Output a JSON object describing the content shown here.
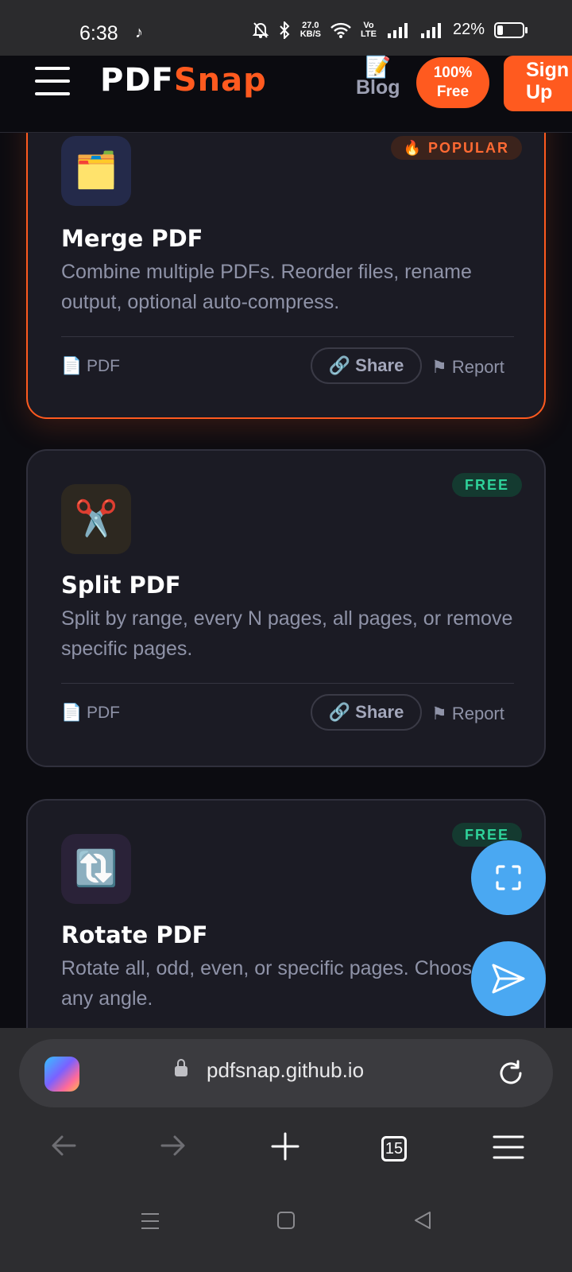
{
  "status_bar": {
    "time": "6:38",
    "speed_value": "27.0",
    "speed_unit": "KB/S",
    "volte_top": "Vo",
    "volte_bottom": "LTE",
    "battery": "22%"
  },
  "navbar": {
    "logo_part1": "PDF",
    "logo_part2": "Snap",
    "blog_label": "Blog",
    "free_line1": "100%",
    "free_line2": "Free",
    "signup_line1": "Sign",
    "signup_line2": "Up"
  },
  "cards": [
    {
      "badge": "🔥 POPULAR",
      "icon": "🗂️",
      "title": "Merge PDF",
      "description": "Combine multiple PDFs. Reorder files, rename output, optional auto-compress.",
      "file_type": "📄 PDF",
      "share_label": "🔗 Share",
      "report_label": "⚑ Report"
    },
    {
      "badge": "FREE",
      "icon": "✂️",
      "title": "Split PDF",
      "description": "Split by range, every N pages, all pages, or remove specific pages.",
      "file_type": "📄 PDF",
      "share_label": "🔗 Share",
      "report_label": "⚑ Report"
    },
    {
      "badge": "FREE",
      "icon": "🔃",
      "title": "Rotate PDF",
      "description": "Rotate all, odd, even, or specific pages. Choose any angle."
    }
  ],
  "browser": {
    "url": "pdfsnap.github.io",
    "tab_count": "15"
  },
  "colors": {
    "accent": "#ff5a1f",
    "card_bg": "#1b1b24",
    "page_bg": "#0c0c11",
    "fab": "#4aa8f2",
    "free_badge_text": "#2fd39a"
  }
}
